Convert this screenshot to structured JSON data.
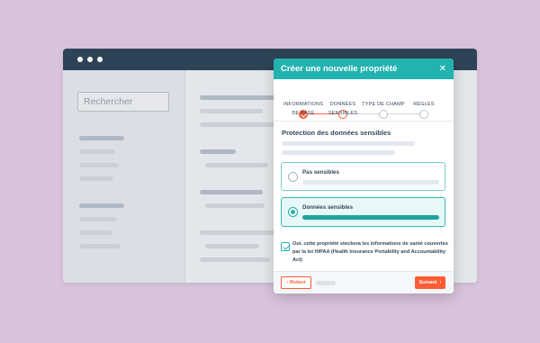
{
  "background_search": {
    "placeholder": "Rechercher"
  },
  "modal": {
    "title": "Créer une nouvelle propriété",
    "close_icon": "close-icon",
    "steps": [
      {
        "label": "INFORMATIONS DE BASE",
        "state": "complete"
      },
      {
        "label": "DONNÉES SENSIBLES",
        "state": "current"
      },
      {
        "label": "TYPE DE CHAMP",
        "state": "upcoming"
      },
      {
        "label": "RÈGLES",
        "state": "upcoming"
      }
    ],
    "section_title": "Protection des données sensibles",
    "options": [
      {
        "label": "Pas sensibles",
        "selected": false
      },
      {
        "label": "Données sensibles",
        "selected": true
      }
    ],
    "consent": {
      "checked": true,
      "text": "Oui, cette propriété stockera les informations de santé couvertes par la loi HIPAA (Health Insurance Portability and Accountability Act)"
    },
    "footer": {
      "back_label": "Retour",
      "next_label": "Suivant"
    }
  },
  "colors": {
    "header": "#22b3b0",
    "accent": "#ff5c35",
    "navy": "#2f4358",
    "background": "#d9c3dc"
  }
}
